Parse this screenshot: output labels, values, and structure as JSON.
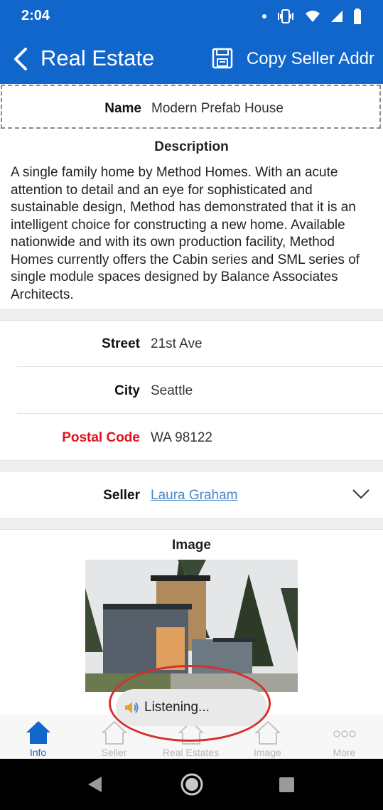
{
  "status_bar": {
    "time": "2:04"
  },
  "app_bar": {
    "title": "Real Estate",
    "copy_action": "Copy Seller Addr"
  },
  "fields": {
    "name": {
      "label": "Name",
      "value": "Modern Prefab House"
    },
    "description": {
      "label": "Description",
      "text": "A single family home by Method Homes. With an acute attention to detail and an eye for sophisticated and sustainable design, Method has demonstrated that it is an intelligent choice for constructing a new home. Available nationwide and with its own production facility, Method Homes currently offers the Cabin series and SML series of single module spaces designed by Balance Associates Architects."
    },
    "street": {
      "label": "Street",
      "value": "21st Ave"
    },
    "city": {
      "label": "City",
      "value": "Seattle"
    },
    "postal_code": {
      "label": "Postal Code",
      "value": "WA 98122"
    },
    "seller": {
      "label": "Seller",
      "value": "Laura Graham"
    },
    "image": {
      "label": "Image"
    }
  },
  "toast": {
    "text": "Listening..."
  },
  "bottom_nav": {
    "tabs": [
      {
        "label": "Info",
        "icon": "home-icon"
      },
      {
        "label": "Seller",
        "icon": "home-icon"
      },
      {
        "label": "Real Estates",
        "icon": "home-icon"
      },
      {
        "label": "Image",
        "icon": "home-icon"
      },
      {
        "label": "More",
        "icon": "more-icon"
      }
    ]
  },
  "colors": {
    "primary": "#1166cc",
    "required_label": "#e2101b",
    "link": "#4a86c8",
    "highlight_circle": "#d62f2f"
  }
}
